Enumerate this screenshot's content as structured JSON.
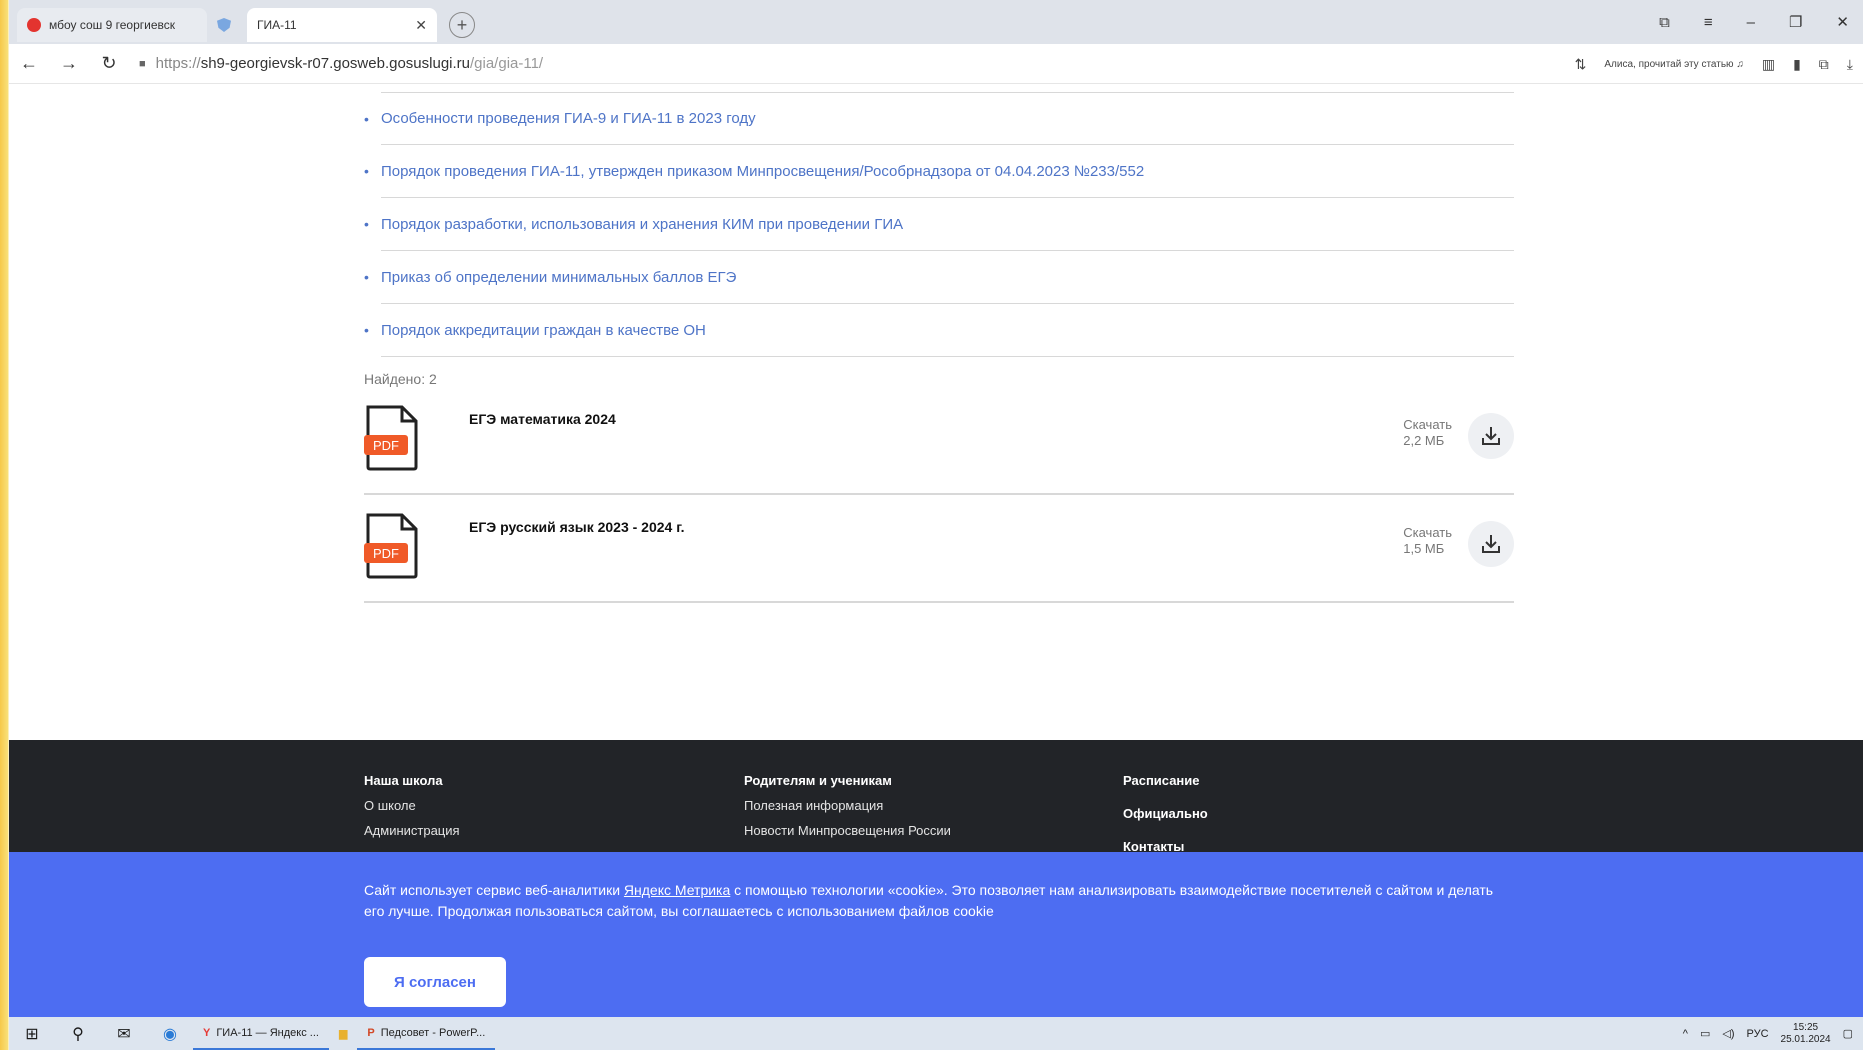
{
  "browser": {
    "tabs": [
      {
        "label": "мбоу сош 9 георгиевск"
      },
      {
        "label": ""
      },
      {
        "label": "ГИА-11"
      }
    ],
    "url": {
      "scheme": "https://",
      "host": "sh9-georgievsk-r07.gosweb.gosuslugi.ru",
      "path": "/gia/gia-11/"
    },
    "alice_label": "Алиса, прочитай эту статью"
  },
  "doc_links": [
    "Особенности проведения ГИА-9 и ГИА-11 в 2023 году",
    "Порядок проведения ГИА-11, утвержден приказом Минпросвещения/Рособрнадзора от 04.04.2023 №233/552",
    "Порядок разработки, использования и хранения КИМ при проведении ГИА",
    "Приказ об определении минимальных баллов ЕГЭ",
    "Порядок аккредитации граждан в качестве ОН"
  ],
  "found_label": "Найдено: 2",
  "files": [
    {
      "title": "ЕГЭ математика 2024",
      "type": "PDF",
      "download_label": "Скачать",
      "size": "2,2 МБ"
    },
    {
      "title": "ЕГЭ русский язык 2023 - 2024 г.",
      "type": "PDF",
      "download_label": "Скачать",
      "size": "1,5 МБ"
    }
  ],
  "footer": {
    "col1": {
      "heading": "Наша школа",
      "items": [
        "О школе",
        "Администрация"
      ]
    },
    "col2": {
      "heading": "Родителям и ученикам",
      "items": [
        "Полезная информация",
        "Новости Минпросвещения России"
      ]
    },
    "col3": {
      "items": [
        "Расписание",
        "Официально",
        "Контакты"
      ]
    }
  },
  "cookie": {
    "text_before": "Сайт использует сервис веб-аналитики ",
    "link": "Яндекс Метрика",
    "text_after": " с помощью технологии «cookie». Это позволяет нам анализировать взаимодействие посетителей с сайтом и делать его лучше. Продолжая пользоваться сайтом, вы соглашаетесь с использованием файлов cookie",
    "button": "Я согласен"
  },
  "taskbar": {
    "apps": [
      {
        "label": "ГИА-11 — Яндекс ..."
      },
      {
        "label": ""
      },
      {
        "label": "Педсовет - PowerP..."
      }
    ],
    "lang": "РУС",
    "time": "15:25",
    "date": "25.01.2024"
  },
  "colors": {
    "link": "#4e74c7",
    "cookie_bg": "#4d6df2",
    "footer_bg": "#222428",
    "pdf_badge": "#f05a28"
  }
}
